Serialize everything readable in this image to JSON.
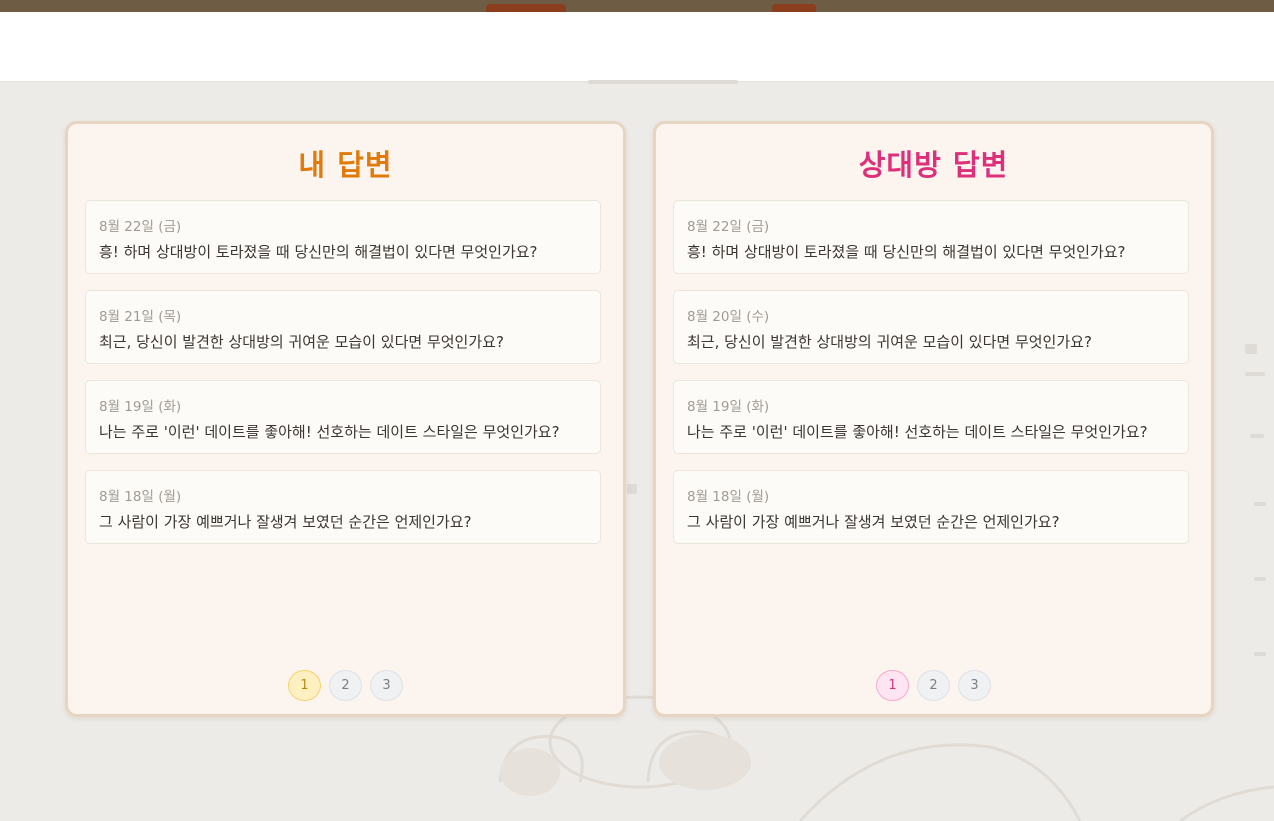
{
  "panels": {
    "mine": {
      "title": "내 답변",
      "accent": "#e07a0a",
      "items": [
        {
          "date": "8월 22일 (금)",
          "question": "흥! 하며 상대방이 토라졌을 때 당신만의 해결법이 있다면 무엇인가요?"
        },
        {
          "date": "8월 21일 (목)",
          "question": "최근, 당신이 발견한 상대방의 귀여운 모습이 있다면 무엇인가요?"
        },
        {
          "date": "8월 19일 (화)",
          "question": "나는 주로 '이런' 데이트를 좋아해! 선호하는 데이트 스타일은 무엇인가요?"
        },
        {
          "date": "8월 18일 (월)",
          "question": "그 사람이 가장 예쁘거나 잘생겨 보였던 순간은 언제인가요?"
        }
      ],
      "pages": [
        "1",
        "2",
        "3"
      ],
      "active_page": "1"
    },
    "partner": {
      "title": "상대방 답변",
      "accent": "#de2f7a",
      "items": [
        {
          "date": "8월 22일 (금)",
          "question": "흥! 하며 상대방이 토라졌을 때 당신만의 해결법이 있다면 무엇인가요?"
        },
        {
          "date": "8월 20일 (수)",
          "question": "최근, 당신이 발견한 상대방의 귀여운 모습이 있다면 무엇인가요?"
        },
        {
          "date": "8월 19일 (화)",
          "question": "나는 주로 '이런' 데이트를 좋아해! 선호하는 데이트 스타일은 무엇인가요?"
        },
        {
          "date": "8월 18일 (월)",
          "question": "그 사람이 가장 예쁘거나 잘생겨 보였던 순간은 언제인가요?"
        }
      ],
      "pages": [
        "1",
        "2",
        "3"
      ],
      "active_page": "1"
    }
  }
}
